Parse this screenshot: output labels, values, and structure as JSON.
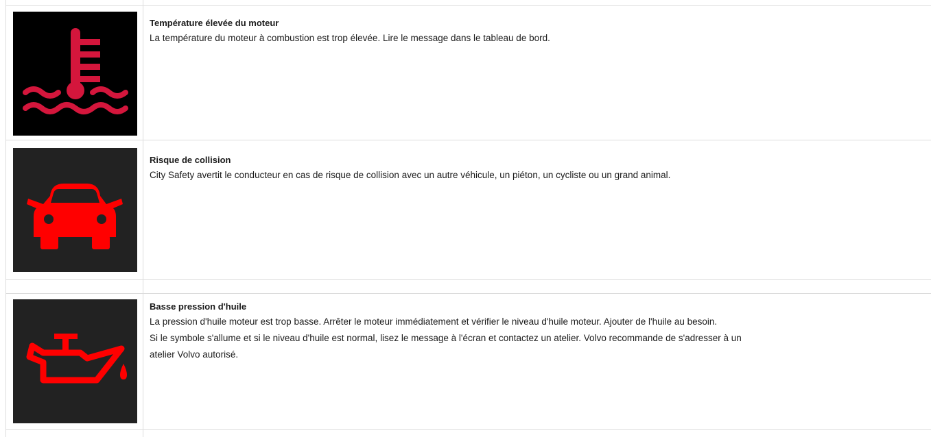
{
  "rows": [
    {
      "icon": "engine-temperature-icon",
      "icon_color": "#d4163c",
      "icon_background": "#000000",
      "title": "Température élevée du moteur",
      "lines": [
        "La température du moteur à combustion est trop élevée. Lire le message dans le tableau de bord."
      ]
    },
    {
      "icon": "collision-warning-car-icon",
      "icon_color": "#ff0000",
      "icon_background": "#222222",
      "title": "Risque de collision",
      "lines": [
        "City Safety avertit le conducteur en cas de risque de collision avec un autre véhicule, un piéton, un cycliste ou un grand animal."
      ]
    },
    {
      "icon": "oil-pressure-icon",
      "icon_color": "#ff0000",
      "icon_background": "#222222",
      "title": "Basse pression d'huile",
      "lines": [
        "La pression d'huile moteur est trop basse. Arrêter le moteur immédiatement et vérifier le niveau d'huile moteur. Ajouter de l'huile au besoin.",
        "Si le symbole s'allume et si le niveau d'huile est normal, lisez le message à l'écran et contactez un atelier. Volvo recommande de s'adresser à un",
        "atelier Volvo autorisé."
      ]
    }
  ]
}
